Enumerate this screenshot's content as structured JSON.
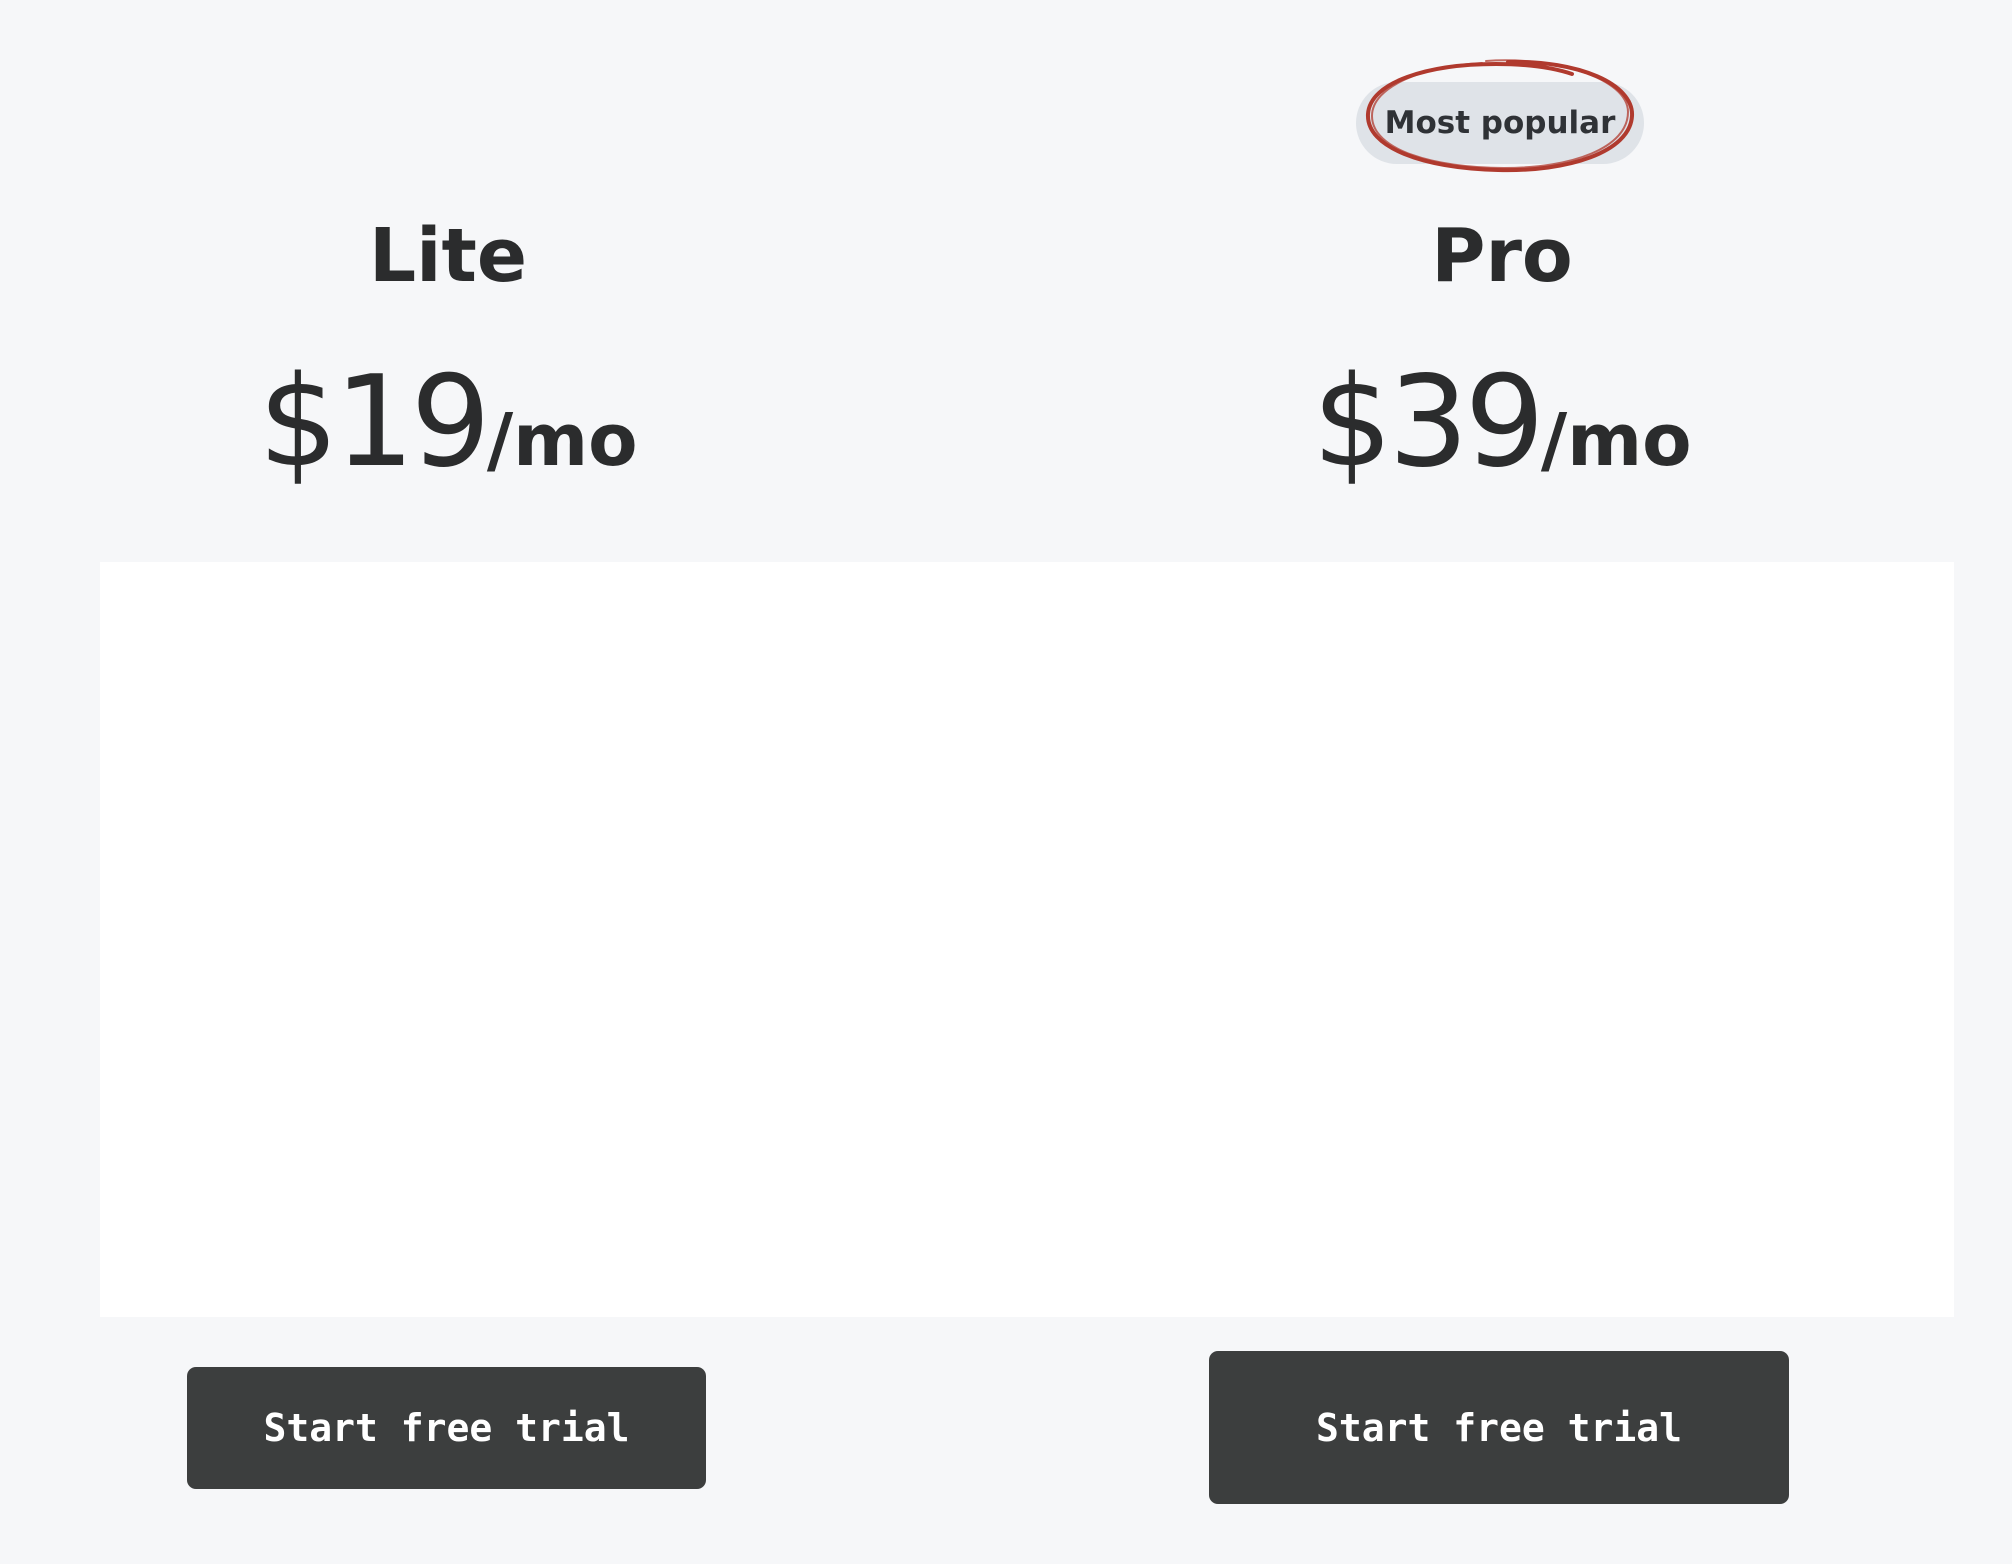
{
  "plans": [
    {
      "name": "Lite",
      "price": "$19",
      "period": "/mo",
      "cta_label": "Start free trial"
    },
    {
      "name": "Pro",
      "price": "$39",
      "period": "/mo",
      "badge": "Most popular",
      "cta_label": "Start free trial"
    }
  ],
  "colors": {
    "page_background": "#f6f7f9",
    "panel_background": "#ffffff",
    "badge_background": "#dfe3e8",
    "badge_annotation": "#b03a2e",
    "button_background": "#3c3e3e",
    "button_text": "#ffffff",
    "text": "#2b2c2d"
  }
}
